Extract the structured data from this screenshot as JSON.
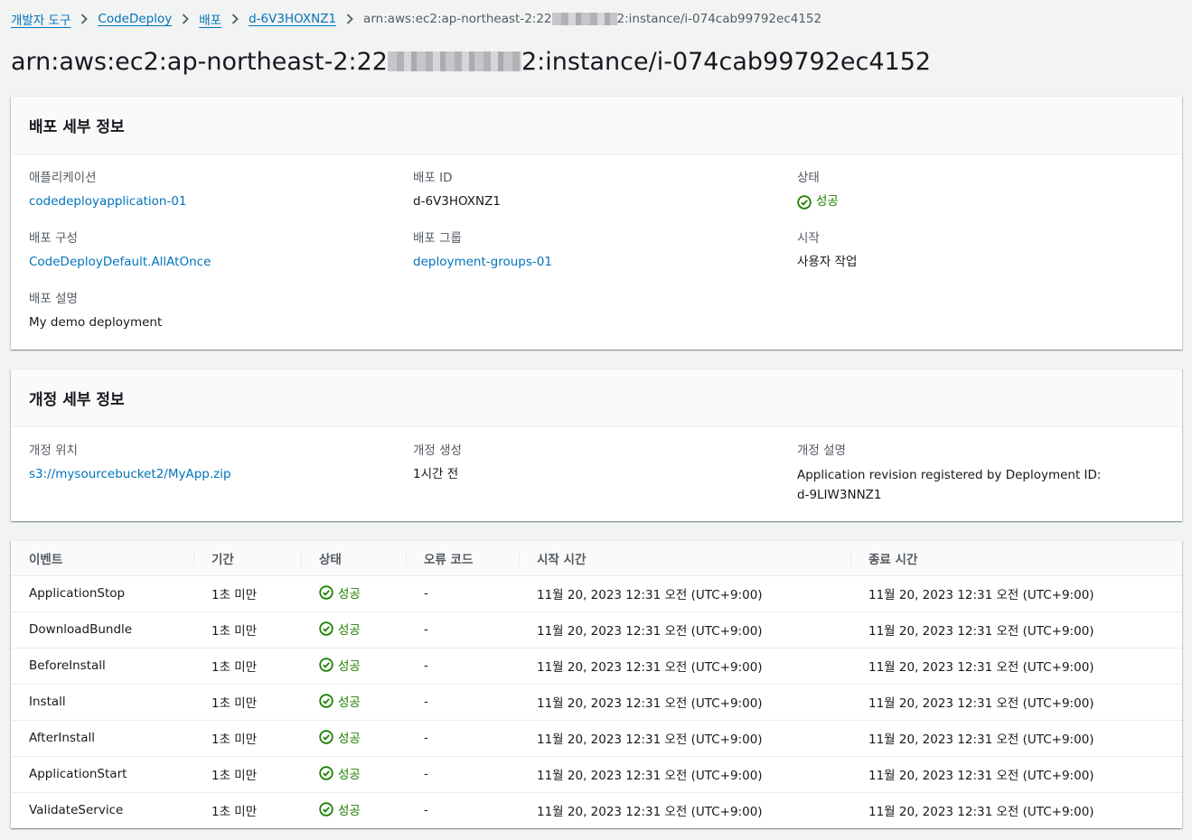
{
  "breadcrumb": {
    "items": [
      "개발자 도구",
      "CodeDeploy",
      "배포",
      "d-6V3HOXNZ1"
    ],
    "current_prefix": "arn:aws:ec2:ap-northeast-2:22",
    "current_suffix": "2:instance/i-074cab99792ec4152"
  },
  "title": {
    "prefix": "arn:aws:ec2:ap-northeast-2:22",
    "suffix": "2:instance/i-074cab99792ec4152"
  },
  "deployment_details": {
    "header": "배포 세부 정보",
    "application_label": "애플리케이션",
    "application_value": "codedeployapplication-01",
    "deployment_id_label": "배포 ID",
    "deployment_id_value": "d-6V3HOXNZ1",
    "status_label": "상태",
    "status_value": "성공",
    "config_label": "배포 구성",
    "config_value": "CodeDeployDefault.AllAtOnce",
    "group_label": "배포 그룹",
    "group_value": "deployment-groups-01",
    "initiated_label": "시작",
    "initiated_value": "사용자 작업",
    "description_label": "배포 설명",
    "description_value": "My demo deployment"
  },
  "revision_details": {
    "header": "개정 세부 정보",
    "location_label": "개정 위치",
    "location_value": "s3://mysourcebucket2/MyApp.zip",
    "created_label": "개정 생성",
    "created_value": "1시간 전",
    "description_label": "개정 설명",
    "description_value": "Application revision registered by Deployment ID: d-9LIW3NNZ1"
  },
  "events": {
    "columns": [
      "이벤트",
      "기간",
      "상태",
      "오류 코드",
      "시작 시간",
      "종료 시간"
    ],
    "rows": [
      {
        "event": "ApplicationStop",
        "duration": "1초 미만",
        "status": "성공",
        "error": "-",
        "start": "11월 20, 2023 12:31 오전 (UTC+9:00)",
        "end": "11월 20, 2023 12:31 오전 (UTC+9:00)"
      },
      {
        "event": "DownloadBundle",
        "duration": "1초 미만",
        "status": "성공",
        "error": "-",
        "start": "11월 20, 2023 12:31 오전 (UTC+9:00)",
        "end": "11월 20, 2023 12:31 오전 (UTC+9:00)"
      },
      {
        "event": "BeforeInstall",
        "duration": "1초 미만",
        "status": "성공",
        "error": "-",
        "start": "11월 20, 2023 12:31 오전 (UTC+9:00)",
        "end": "11월 20, 2023 12:31 오전 (UTC+9:00)"
      },
      {
        "event": "Install",
        "duration": "1초 미만",
        "status": "성공",
        "error": "-",
        "start": "11월 20, 2023 12:31 오전 (UTC+9:00)",
        "end": "11월 20, 2023 12:31 오전 (UTC+9:00)"
      },
      {
        "event": "AfterInstall",
        "duration": "1초 미만",
        "status": "성공",
        "error": "-",
        "start": "11월 20, 2023 12:31 오전 (UTC+9:00)",
        "end": "11월 20, 2023 12:31 오전 (UTC+9:00)"
      },
      {
        "event": "ApplicationStart",
        "duration": "1초 미만",
        "status": "성공",
        "error": "-",
        "start": "11월 20, 2023 12:31 오전 (UTC+9:00)",
        "end": "11월 20, 2023 12:31 오전 (UTC+9:00)"
      },
      {
        "event": "ValidateService",
        "duration": "1초 미만",
        "status": "성공",
        "error": "-",
        "start": "11월 20, 2023 12:31 오전 (UTC+9:00)",
        "end": "11월 20, 2023 12:31 오전 (UTC+9:00)"
      }
    ]
  },
  "icons": {
    "breadcrumb_separator": "chevron-right-icon",
    "status": "check-circle-icon"
  },
  "colors": {
    "link": "#0073bb",
    "success": "#1d8102",
    "label": "#545b64",
    "background": "#f2f3f3"
  }
}
